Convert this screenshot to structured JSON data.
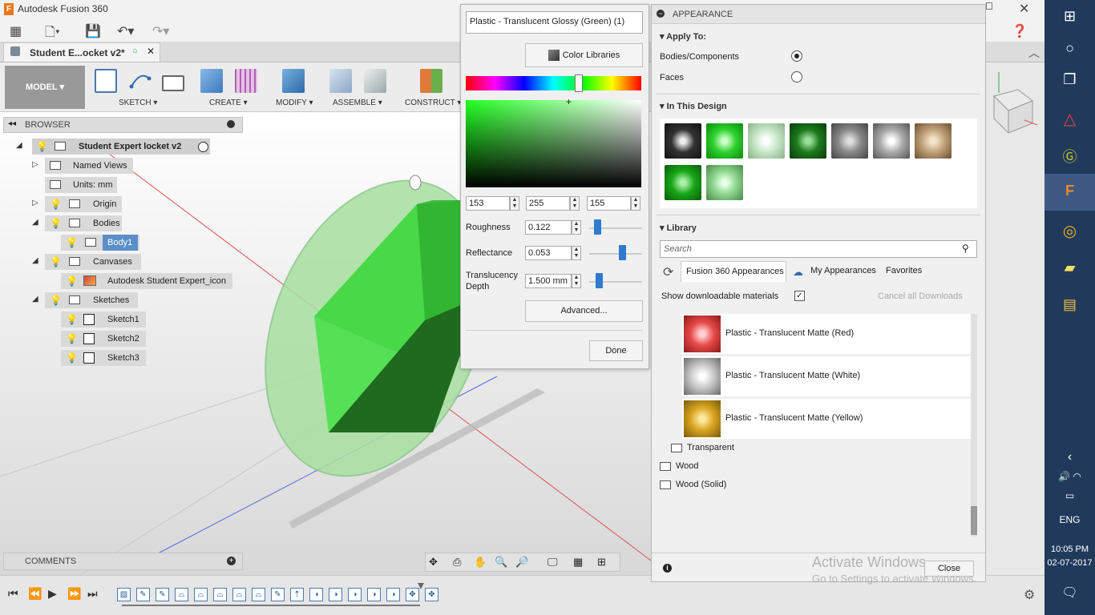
{
  "app": {
    "title": "Autodesk Fusion 360",
    "doc_tab": "Student E...ocket v2*",
    "logo_letter": "F"
  },
  "toolbar": {
    "workspace": "MODEL ▾",
    "groups": [
      "SKETCH ▾",
      "CREATE ▾",
      "MODIFY ▾",
      "ASSEMBLE ▾",
      "CONSTRUCT ▾"
    ]
  },
  "browser": {
    "title": "BROWSER",
    "root": "Student Expert locket v2",
    "items": [
      {
        "label": "Named Views"
      },
      {
        "label": "Units: mm"
      },
      {
        "label": "Origin"
      },
      {
        "label": "Bodies"
      },
      {
        "label": "Body1"
      },
      {
        "label": "Canvases"
      },
      {
        "label": "Autodesk Student Expert_icon"
      },
      {
        "label": "Sketches"
      },
      {
        "label": "Sketch1"
      },
      {
        "label": "Sketch2"
      },
      {
        "label": "Sketch3"
      }
    ]
  },
  "comments": {
    "title": "COMMENTS"
  },
  "color_dialog": {
    "name": "Plastic - Translucent Glossy (Green) (1)",
    "color_libraries": "Color Libraries",
    "rgb": [
      "153",
      "255",
      "155"
    ],
    "roughness_label": "Roughness",
    "roughness": "0.122",
    "roughness_level": 0.122,
    "reflectance_label": "Reflectance",
    "reflectance": "0.053",
    "reflectance_level": 0.6,
    "translucency_label_1": "Translucency",
    "translucency_label_2": "Depth",
    "translucency": "1.500 mm",
    "translucency_level": 0.15,
    "advanced": "Advanced...",
    "done": "Done"
  },
  "appearance": {
    "title": "APPEARANCE",
    "apply_to": "Apply To:",
    "bodies": "Bodies/Components",
    "faces": "Faces",
    "in_this_design": "In This Design",
    "library": "Library",
    "search_placeholder": "Search",
    "tabs": [
      "Fusion 360 Appearances",
      "My Appearances",
      "Favorites"
    ],
    "show_downloadable": "Show downloadable materials",
    "cancel_downloads": "Cancel all Downloads",
    "materials": [
      {
        "name": "Plastic - Translucent Matte (Red)",
        "color": "#e84a4a"
      },
      {
        "name": "Plastic - Translucent Matte (White)",
        "color": "#c9c9c9"
      },
      {
        "name": "Plastic - Translucent Matte (Yellow)",
        "color": "#d9a521"
      }
    ],
    "folders": [
      "Transparent",
      "Wood",
      "Wood (Solid)"
    ],
    "close": "Close",
    "watermark_1": "Activate Windows",
    "watermark_2": "Go to Settings to activate Windows."
  },
  "system": {
    "time": "10:05 PM",
    "date": "02-07-2017",
    "lang": "ENG"
  },
  "colors": {
    "accent": "#2e7bcf",
    "taskbar": "#213a5c",
    "green_body": "#3fd23f"
  }
}
